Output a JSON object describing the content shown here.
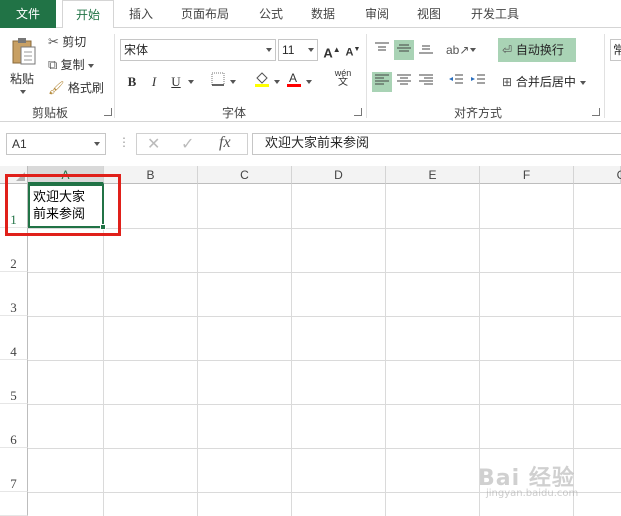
{
  "tabs": {
    "file": "文件",
    "home": "开始",
    "insert": "插入",
    "page_layout": "页面布局",
    "formulas": "公式",
    "data": "数据",
    "review": "审阅",
    "view": "视图",
    "developer": "开发工具"
  },
  "clipboard": {
    "paste": "粘贴",
    "cut": "剪切",
    "copy": "复制",
    "format_painter": "格式刷",
    "label": "剪贴板"
  },
  "font": {
    "name": "宋体",
    "size": "11",
    "bold": "B",
    "italic": "I",
    "underline": "U",
    "grow": "A",
    "shrink": "A",
    "phonetic": "wén",
    "label": "字体",
    "font_color_indicator": "#ff0000",
    "fill_color_indicator": "#ffff00"
  },
  "alignment": {
    "wrap_text": "自动换行",
    "merge_center": "合并后居中",
    "label": "对齐方式"
  },
  "number": {
    "format_partial": "常"
  },
  "formula_bar": {
    "name_box": "A1",
    "fx": "fx",
    "content": "欢迎大家前来参阅"
  },
  "grid": {
    "columns": [
      "A",
      "B",
      "C",
      "D",
      "E",
      "F",
      "G"
    ],
    "rows": [
      "1",
      "2",
      "3",
      "4",
      "5",
      "6",
      "7"
    ],
    "a1_line1": "欢迎大家",
    "a1_line2": "前来参阅"
  },
  "colors": {
    "accent": "#217346",
    "selected_button": "#a9d3b5",
    "highlight_box": "#e0201a"
  },
  "watermark": {
    "text": "Bai 经验",
    "sub": "jingyan.baidu.com"
  }
}
